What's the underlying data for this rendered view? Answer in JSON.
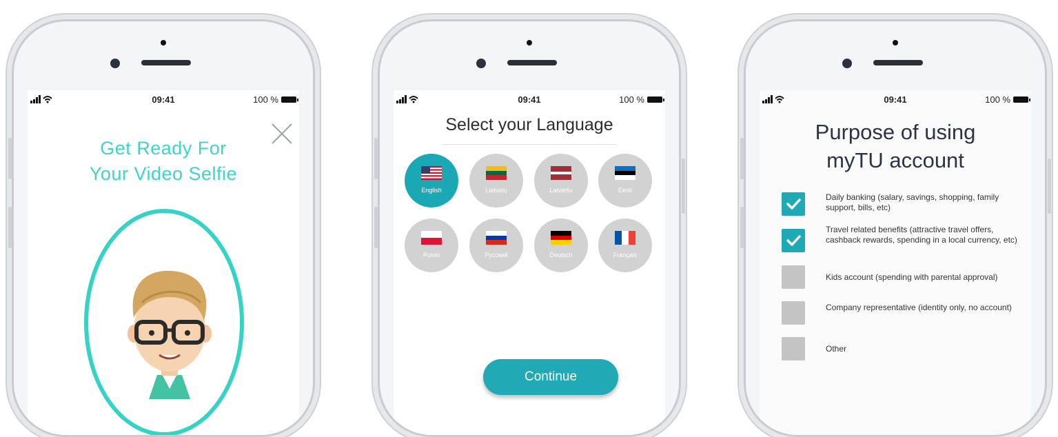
{
  "status_bar": {
    "time": "09:41",
    "battery": "100 %"
  },
  "screen1": {
    "title_line1": "Get Ready For",
    "title_line2": "Your Video Selfie"
  },
  "screen2": {
    "title": "Select your Language",
    "languages": [
      {
        "label": "English",
        "flag": "us-flag-icon",
        "selected": true
      },
      {
        "label": "Lietuvių",
        "flag": "lithuania-flag-icon",
        "selected": false
      },
      {
        "label": "Latviešu",
        "flag": "latvia-flag-icon",
        "selected": false
      },
      {
        "label": "Eesti",
        "flag": "estonia-flag-icon",
        "selected": false
      },
      {
        "label": "Polski",
        "flag": "poland-flag-icon",
        "selected": false
      },
      {
        "label": "Русский",
        "flag": "russia-flag-icon",
        "selected": false
      },
      {
        "label": "Deutsch",
        "flag": "germany-flag-icon",
        "selected": false
      },
      {
        "label": "Français",
        "flag": "france-flag-icon",
        "selected": false
      }
    ],
    "continue_label": "Continue"
  },
  "screen3": {
    "title_line1": "Purpose of using",
    "title_line2": "myTU account",
    "options": [
      {
        "label": "Daily banking (salary, savings, shopping, family support, bills, etc)",
        "checked": true
      },
      {
        "label": " Travel related benefits (attractive travel offers, cashback rewards, spending in a local currency, etc)",
        "checked": true
      },
      {
        "label": "Kids account (spending with parental approval)",
        "checked": false
      },
      {
        "label": "Company representative (identity only, no account)",
        "checked": false
      },
      {
        "label": "Other",
        "checked": false
      }
    ]
  },
  "colors": {
    "teal": "#35d3c6",
    "accent": "#1aa8b5",
    "unchecked": "#c4c4c4"
  }
}
